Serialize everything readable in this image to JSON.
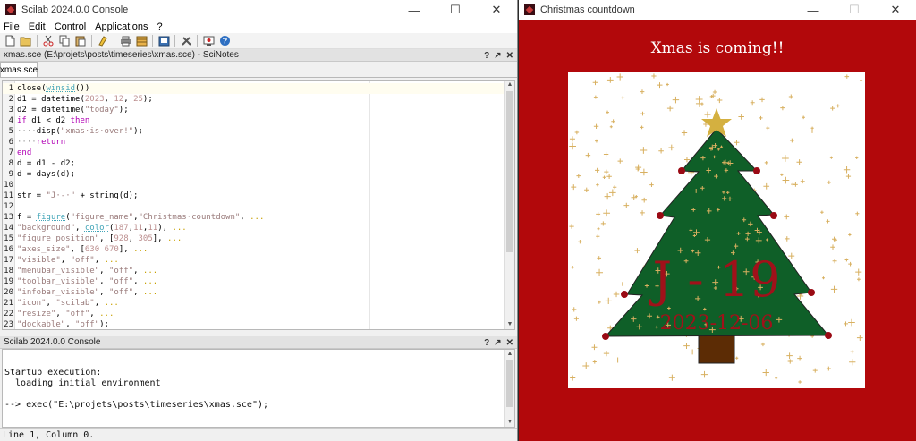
{
  "console_window": {
    "title": "Scilab 2024.0.0 Console",
    "controls": {
      "minimize": "—",
      "maximize": "☐",
      "close": "✕"
    },
    "menu": [
      "File",
      "Edit",
      "Control",
      "Applications",
      "?"
    ],
    "toolbar_icons": [
      "new-file-icon",
      "open-folder-icon",
      "cut-icon",
      "copy-icon",
      "paste-icon",
      "clear-icon",
      "print-icon",
      "variable-browser-icon",
      "editor-icon",
      "toolbox-icon",
      "demos-icon",
      "help-icon"
    ],
    "scinotes_header": "xmas.sce (E:\\projets\\posts\\timeseries\\xmas.sce) - SciNotes",
    "panel_controls": [
      "?",
      "↗",
      "✕"
    ],
    "tab_label": "xmas.sce",
    "code_lines": [
      {
        "n": "1",
        "html": "close(<span class=\"k-fn\">winsid</span>())"
      },
      {
        "n": "2",
        "html": "d1 = datetime(<span class=\"k-num\">2023</span>, <span class=\"k-num\">12</span>, <span class=\"k-num\">25</span>);"
      },
      {
        "n": "3",
        "html": "d2 = datetime(<span class=\"k-str\">\"today\"</span>);"
      },
      {
        "n": "4",
        "html": "<span class=\"k-kw\">if</span> d1 &lt; d2 <span class=\"k-kw\">then</span>"
      },
      {
        "n": "5",
        "html": "<span class=\"k-mute\">····</span>disp(<span class=\"k-str\">\"xmas·is·over!\"</span>);"
      },
      {
        "n": "6",
        "html": "<span class=\"k-mute\">····</span><span class=\"k-kw\">return</span>"
      },
      {
        "n": "7",
        "html": "<span class=\"k-kw\">end</span>"
      },
      {
        "n": "8",
        "html": "d = d1 - d2;"
      },
      {
        "n": "9",
        "html": "d = days(d);"
      },
      {
        "n": "10",
        "html": ""
      },
      {
        "n": "11",
        "html": "str = <span class=\"k-str\">\"J·-·\"</span> + string(d);"
      },
      {
        "n": "12",
        "html": ""
      },
      {
        "n": "13",
        "html": "f = <span class=\"k-fn\">figure</span>(<span class=\"k-str\">\"figure_name\"</span>,<span class=\"k-str\">\"Christmas·countdown\"</span>, <span class=\"k-ell\">...</span>"
      },
      {
        "n": "14",
        "html": "<span class=\"k-str\">\"background\"</span>, <span class=\"k-fn\">color</span>(<span class=\"k-num\">187</span>,<span class=\"k-num\">11</span>,<span class=\"k-num\">11</span>), <span class=\"k-ell\">...</span>"
      },
      {
        "n": "15",
        "html": "<span class=\"k-str\">\"figure_position\"</span>, [<span class=\"k-num\">928</span>, <span class=\"k-num\">305</span>], <span class=\"k-ell\">...</span>"
      },
      {
        "n": "16",
        "html": "<span class=\"k-str\">\"axes_size\"</span>, [<span class=\"k-num\">630</span> <span class=\"k-num\">670</span>], <span class=\"k-ell\">...</span>"
      },
      {
        "n": "17",
        "html": "<span class=\"k-str\">\"visible\"</span>, <span class=\"k-str\">\"off\"</span>, <span class=\"k-ell\">...</span>"
      },
      {
        "n": "18",
        "html": "<span class=\"k-str\">\"menubar_visible\"</span>, <span class=\"k-str\">\"off\"</span>, <span class=\"k-ell\">...</span>"
      },
      {
        "n": "19",
        "html": "<span class=\"k-str\">\"toolbar_visible\"</span>, <span class=\"k-str\">\"off\"</span>, <span class=\"k-ell\">...</span>"
      },
      {
        "n": "20",
        "html": "<span class=\"k-str\">\"infobar_visible\"</span>, <span class=\"k-str\">\"off\"</span>, <span class=\"k-ell\">...</span>"
      },
      {
        "n": "21",
        "html": "<span class=\"k-str\">\"icon\"</span>, <span class=\"k-str\">\"scilab\"</span>, <span class=\"k-ell\">...</span>"
      },
      {
        "n": "22",
        "html": "<span class=\"k-str\">\"resize\"</span>, <span class=\"k-str\">\"off\"</span>, <span class=\"k-ell\">...</span>"
      },
      {
        "n": "23",
        "html": "<span class=\"k-str\">\"dockable\"</span>, <span class=\"k-str\">\"off\"</span>);"
      }
    ],
    "console_header": "Scilab 2024.0.0 Console",
    "console_lines": [
      "",
      "Startup execution:",
      "  loading initial environment",
      "",
      "--> exec(\"E:\\projets\\posts\\timeseries\\xmas.sce\");"
    ],
    "status": "Line 1, Column 0."
  },
  "xmas_window": {
    "title": "Christmas countdown",
    "controls": {
      "minimize": "—",
      "maximize": "☐",
      "close": "✕"
    },
    "heading": "Xmas is coming!!",
    "countdown": "J - 19",
    "date": "2023-12-06",
    "colors": {
      "background": "#b2080b",
      "tree": "#0f5f28",
      "trunk": "#5c2c05",
      "star": "#d4b040",
      "sparkle": "#d8b060",
      "ornament": "#9a0a14",
      "countdown_text": "#a0111a"
    }
  }
}
